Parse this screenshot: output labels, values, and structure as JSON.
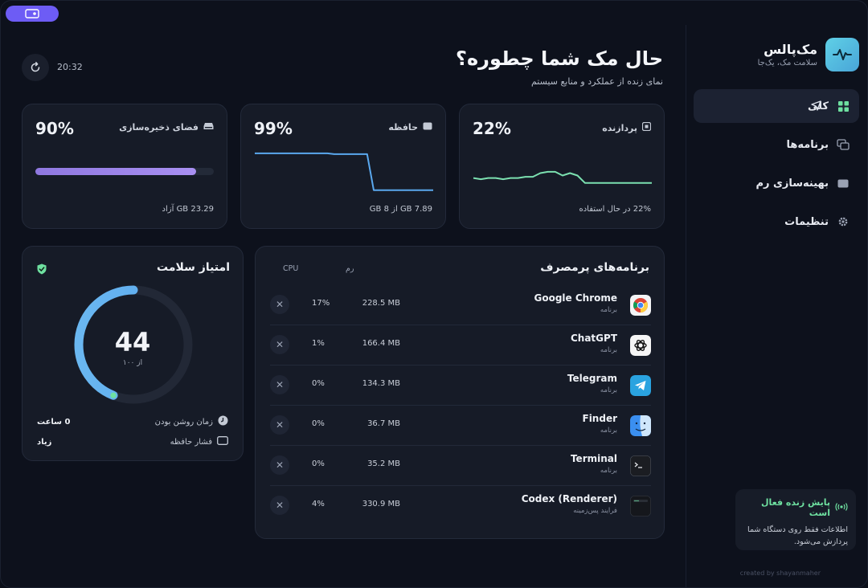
{
  "header": {
    "title": "حال مک شما چطوره؟",
    "subtitle": "نمای زنده از عملکرد و منابع سیستم",
    "time": "20:32"
  },
  "brand": {
    "name": "مک‌پالس",
    "tagline": "سلامت مک، یک‌جا"
  },
  "nav": [
    {
      "label": "کلی",
      "icon": "grid-icon",
      "active": true
    },
    {
      "label": "برنامه‌ها",
      "icon": "windows-icon",
      "active": false
    },
    {
      "label": "بهینه‌سازی رم",
      "icon": "memory-icon",
      "active": false
    },
    {
      "label": "تنظیمات",
      "icon": "gear-icon",
      "active": false
    }
  ],
  "live": {
    "title": "پایش زنده فعال است",
    "desc": "اطلاعات فقط روی دستگاه شما پردازش می‌شود."
  },
  "credit": "created by shayanmaher",
  "cards": {
    "cpu": {
      "label": "پردازنده",
      "percent": "22%",
      "foot": "22% در حال استفاده",
      "history": [
        12,
        11,
        12,
        12,
        11,
        12,
        12,
        13,
        13,
        16,
        17,
        17,
        14,
        16,
        14,
        8,
        8,
        8,
        8,
        8,
        8,
        8,
        8,
        8,
        8
      ]
    },
    "memory": {
      "label": "حافظه",
      "percent": "99%",
      "foot": "7.89 GB از 8 GB",
      "history": [
        99,
        99,
        99,
        99,
        99,
        99,
        99,
        99,
        99,
        99,
        99,
        99,
        98,
        98,
        98,
        98,
        98,
        98,
        50,
        50,
        50,
        50,
        50,
        50,
        50,
        50,
        50,
        50
      ]
    },
    "storage": {
      "label": "فضای ذخیره‌سازی",
      "percent": "90%",
      "foot": "23.29 GB آزاد",
      "fill": 0.9
    }
  },
  "health": {
    "title": "امتیاز سلامت",
    "score": "44",
    "of": "از ۱۰۰",
    "score_value": 44,
    "uptime_label": "زمان روشن بودن",
    "uptime_value": "0 ساعت",
    "pressure_label": "فشار حافظه",
    "pressure_value": "زیاد",
    "accent": "#5aa8ee"
  },
  "apps": {
    "title": "برنامه‌های پرمصرف",
    "col_ram": "رم",
    "col_cpu": "CPU",
    "rows": [
      {
        "name": "Google Chrome",
        "type": "برنامه",
        "ram": "228.5 MB",
        "cpu": "17%",
        "icon": "chrome-icon"
      },
      {
        "name": "ChatGPT",
        "type": "برنامه",
        "ram": "166.4 MB",
        "cpu": "1%",
        "icon": "chatgpt-icon"
      },
      {
        "name": "Telegram",
        "type": "برنامه",
        "ram": "134.3 MB",
        "cpu": "0%",
        "icon": "telegram-icon"
      },
      {
        "name": "Finder",
        "type": "برنامه",
        "ram": "36.7 MB",
        "cpu": "0%",
        "icon": "finder-icon"
      },
      {
        "name": "Terminal",
        "type": "برنامه",
        "ram": "35.2 MB",
        "cpu": "0%",
        "icon": "terminal-icon"
      },
      {
        "name": "Codex (Renderer)",
        "type": "فرایند پس‌زمینه",
        "ram": "330.9 MB",
        "cpu": "4%",
        "icon": "codex-icon"
      }
    ]
  },
  "colors": {
    "accent_purple": "#6d5cf5",
    "cpu_line": "#7be0b0",
    "mem_line": "#5aa8ee",
    "live_green": "#6ee0a0"
  }
}
